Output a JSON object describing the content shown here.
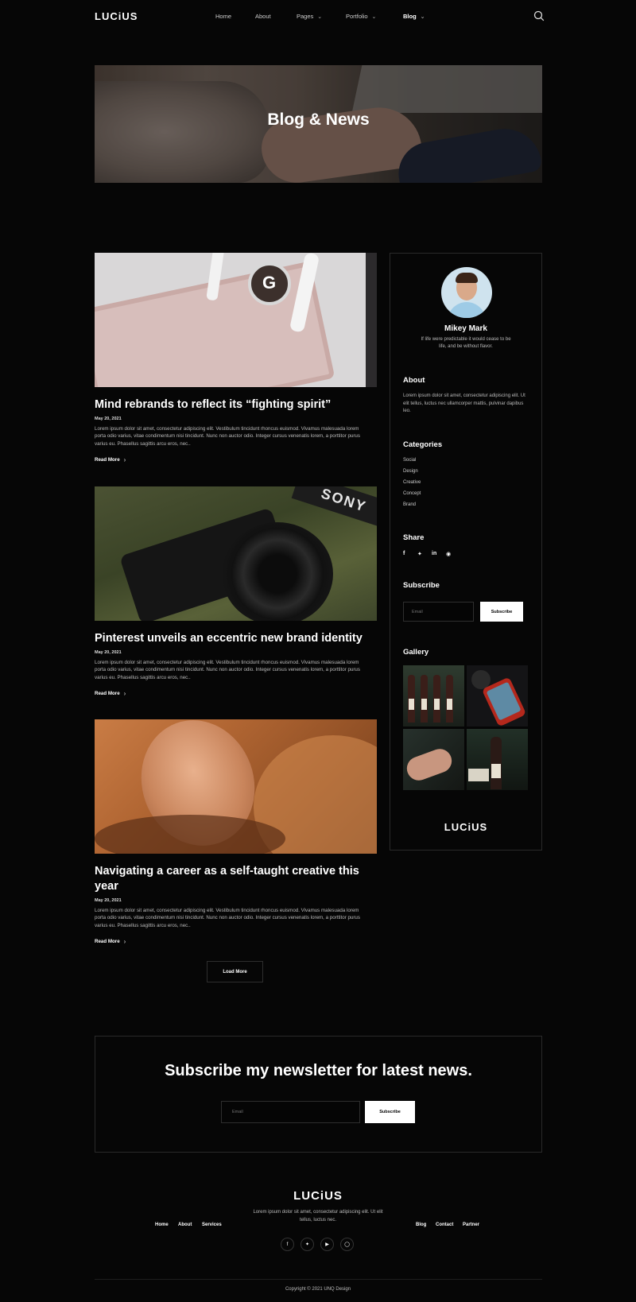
{
  "nav": {
    "logo": "LUCiUS",
    "links": [
      {
        "label": "Home",
        "dropdown": false
      },
      {
        "label": "About",
        "dropdown": false
      },
      {
        "label": "Pages",
        "dropdown": true
      },
      {
        "label": "Portfolio",
        "dropdown": true
      },
      {
        "label": "Blog",
        "dropdown": true
      }
    ],
    "search_icon": "search-icon"
  },
  "hero": {
    "title": "Blog & News"
  },
  "posts": [
    {
      "title": "Mind rebrands to reflect its “fighting spirit”",
      "date": "May 20, 2021",
      "excerpt": "Lorem ipsum dolor sit amet, consectetur adipiscing elit. Vestibulum tincidunt rhoncus euismod. Vivamus malesuada lorem porta odio varius, vitae condimentum nisi tincidunt. Nunc non auctor odio. Integer cursus venenatis lorem, a porttitor purus varius eu. Phasellus sagittis arcu eros, nec..",
      "read_more": "Read More"
    },
    {
      "title": "Pinterest unveils an eccentric new brand identity",
      "date": "May 20, 2021",
      "excerpt": "Lorem ipsum dolor sit amet, consectetur adipiscing elit. Vestibulum tincidunt rhoncus euismod. Vivamus malesuada lorem porta odio varius, vitae condimentum nisi tincidunt. Nunc non auctor odio. Integer cursus venenatis lorem, a porttitor purus varius eu. Phasellus sagittis arcu eros, nec..",
      "read_more": "Read More"
    },
    {
      "title": "Navigating a career as a self-taught creative this year",
      "date": "May 20, 2021",
      "excerpt": "Lorem ipsum dolor sit amet, consectetur adipiscing elit. Vestibulum tincidunt rhoncus euismod. Vivamus malesuada lorem porta odio varius, vitae condimentum nisi tincidunt. Nunc non auctor odio. Integer cursus venenatis lorem, a porttitor purus varius eu. Phasellus sagittis arcu eros, nec..",
      "read_more": "Read More"
    }
  ],
  "load_more": "Load More",
  "sidebar": {
    "author_name": "Mikey Mark",
    "author_bio": "If life were predictable it would cease to be life, and be without flavor.",
    "about_heading": "About",
    "about_text": "Lorem ipsum dolor sit amet, consectetur adipiscing elit. Ut elit tellus, luctus nec ullamcorper mattis, pulvinar dapibus leo.",
    "categories_heading": "Categories",
    "categories": [
      "Social",
      "Design",
      "Creative",
      "Concept",
      "Brand"
    ],
    "share_heading": "Share",
    "share_icons": [
      "facebook-icon",
      "twitter-icon",
      "linkedin-icon",
      "reddit-icon"
    ],
    "subscribe_heading": "Subscribe",
    "email_placeholder": "Email",
    "subscribe_button": "Subscribe",
    "gallery_heading": "Gallery",
    "logo": "LUCiUS"
  },
  "newsletter": {
    "title": "Subscribe my newsletter for latest news.",
    "email_placeholder": "Email",
    "button": "Subscribe"
  },
  "footer": {
    "logo": "LUCiUS",
    "description": "Lorem ipsum dolor sit amet, consectetur adipiscing elit. Ut elit tellus, luctus nec.",
    "links_left": [
      "Home",
      "About",
      "Services"
    ],
    "links_right": [
      "Blog",
      "Contact",
      "Partner"
    ],
    "social_icons": [
      "facebook-icon",
      "twitter-icon",
      "youtube-icon",
      "instagram-icon"
    ],
    "copyright": "Copyright © 2021 UNQ Design"
  }
}
